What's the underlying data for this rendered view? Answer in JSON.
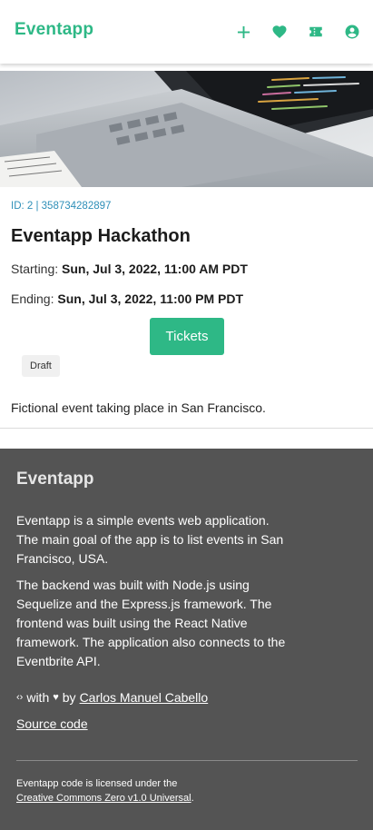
{
  "header": {
    "brand": "Eventapp",
    "nav": [
      "add-icon",
      "heart-icon",
      "ticket-icon",
      "account-icon"
    ],
    "accent": "#2eb886"
  },
  "event": {
    "meta": "ID: 2 | 358734282897",
    "title": "Eventapp Hackathon",
    "start_label": "Starting:",
    "start_value": "Sun, Jul 3, 2022, 11:00 AM PDT",
    "end_label": "Ending:",
    "end_value": "Sun, Jul 3, 2022, 11:00 PM PDT",
    "tickets_label": "Tickets",
    "status": "Draft",
    "description": "Fictional event taking place in San Francisco."
  },
  "footer": {
    "brand": "Eventapp",
    "p1": "Eventapp is a simple events web application. The main goal of the app is to list events in San Francisco, USA.",
    "p2": "The backend was built with Node.js using Sequelize and the Express.js framework. The frontend was built using the React Native framework. The application also connects to the Eventbrite API.",
    "credit_code": "‹›",
    "credit_with": "with",
    "credit_heart": "♥",
    "credit_by": "by",
    "credit_author": "Carlos Manuel Cabello",
    "source_link": "Source code",
    "license_text": "Eventapp code is licensed under the",
    "license_link": "Creative Commons Zero v1.0 Universal",
    "license_period": "."
  }
}
